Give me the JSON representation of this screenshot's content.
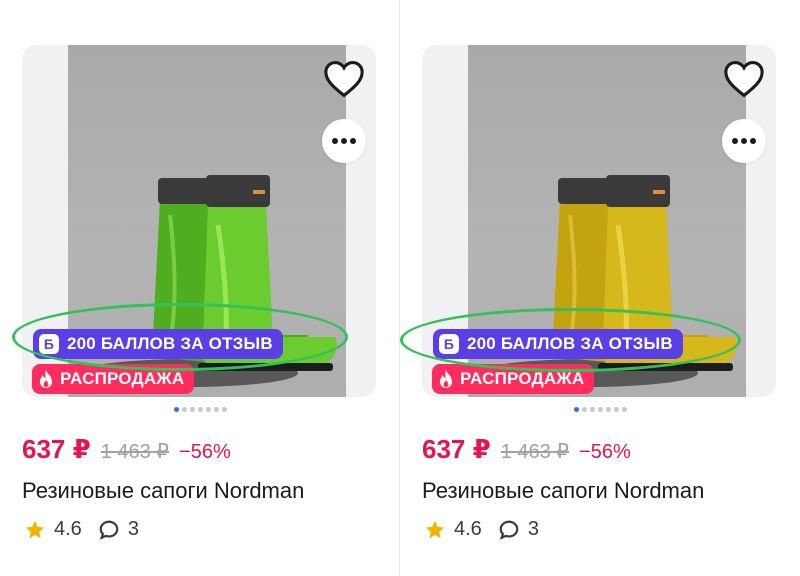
{
  "products": [
    {
      "points_badge": {
        "icon": "Б",
        "text": "200 БАЛЛОВ ЗА ОТЗЫВ"
      },
      "sale_badge": "РАСПРОДАЖА",
      "price": "637 ₽",
      "old_price": "1 463 ₽",
      "discount": "−56%",
      "title": "Резиновые сапоги Nordman",
      "rating": "4.6",
      "reviews": "3",
      "boot_color": "#6ccb2f"
    },
    {
      "points_badge": {
        "icon": "Б",
        "text": "200 БАЛЛОВ ЗА ОТЗЫВ"
      },
      "sale_badge": "РАСПРОДАЖА",
      "price": "637 ₽",
      "old_price": "1 463 ₽",
      "discount": "−56%",
      "title": "Резиновые сапоги Nordman",
      "rating": "4.6",
      "reviews": "3",
      "boot_color": "#d6b81a"
    }
  ],
  "colors": {
    "accent_price": "#e6144d",
    "points_badge": "#5b3fe6",
    "sale_badge": "#ff2d5f",
    "highlight_ellipse": "#33c15a",
    "active_dot": "#2f6df6"
  },
  "icons": [
    "heart-icon",
    "more-icon",
    "flame-icon",
    "star-icon",
    "comment-icon"
  ]
}
